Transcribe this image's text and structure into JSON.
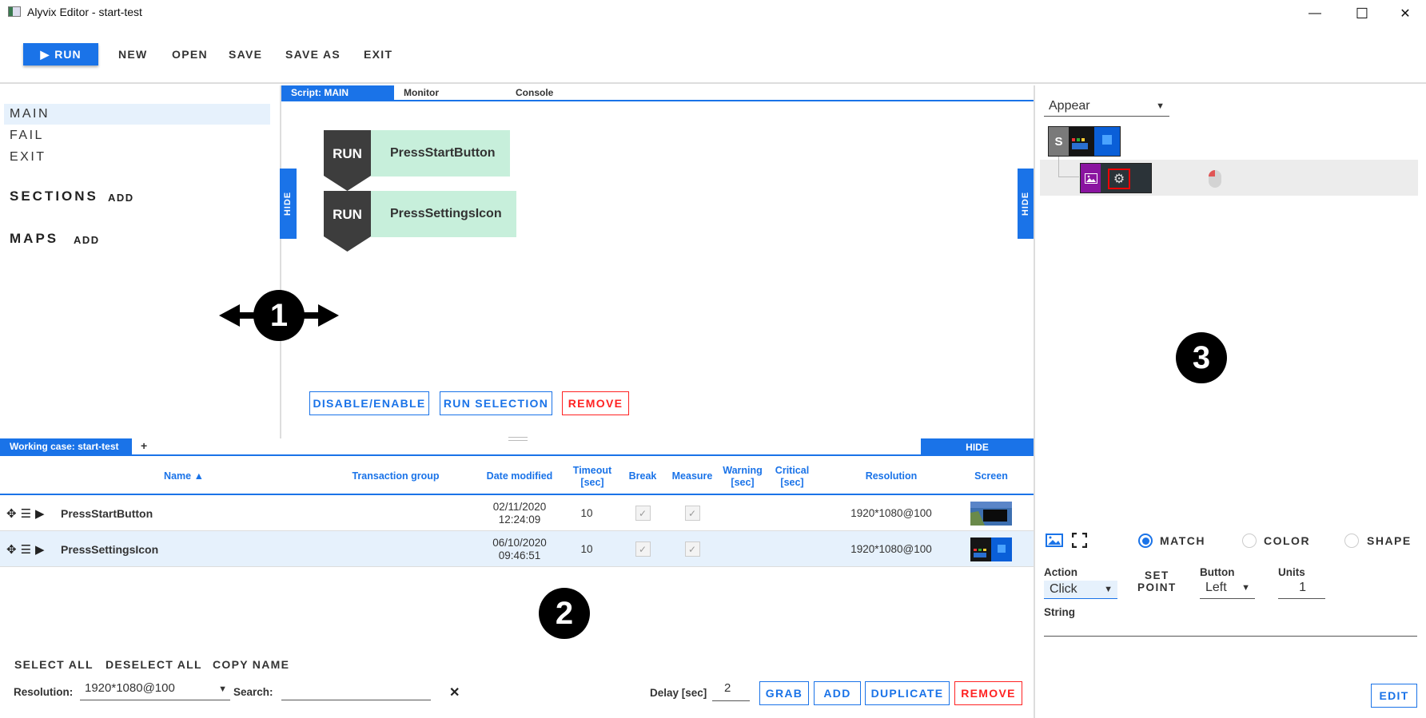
{
  "window": {
    "title": "Alyvix Editor - start-test",
    "controls": {
      "minimize": "—",
      "maximize": "☐",
      "close": "✕"
    }
  },
  "toolbar": {
    "run_label": "RUN",
    "menu": [
      "NEW",
      "OPEN",
      "SAVE",
      "SAVE AS",
      "EXIT"
    ]
  },
  "sidebar": {
    "sections": [
      "MAIN",
      "FAIL",
      "EXIT"
    ],
    "active_section": "MAIN",
    "sections_heading": "SECTIONS",
    "sections_add": "ADD",
    "maps_heading": "MAPS",
    "maps_add": "ADD"
  },
  "center": {
    "tabs": [
      "Script: MAIN",
      "Monitor",
      "Console"
    ],
    "active_tab": "Script: MAIN",
    "hide_label": "HIDE",
    "script_blocks": [
      {
        "keyword": "RUN",
        "name": "PressStartButton"
      },
      {
        "keyword": "RUN",
        "name": "PressSettingsIcon"
      }
    ],
    "buttons": {
      "disable_enable": "DISABLE/ENABLE",
      "run_selection": "RUN SELECTION",
      "remove": "REMOVE"
    }
  },
  "markers": {
    "one": "1",
    "two": "2",
    "three": "3"
  },
  "bottom": {
    "tab_label": "Working case: start-test",
    "add_tab": "+",
    "hide_label": "HIDE",
    "columns": {
      "name": "Name ▲",
      "transaction_group": "Transaction group",
      "date_modified": "Date modified",
      "timeout": "Timeout [sec]",
      "break": "Break",
      "measure": "Measure",
      "warning": "Warning [sec]",
      "critical": "Critical [sec]",
      "resolution": "Resolution",
      "screen": "Screen"
    },
    "rows": [
      {
        "name": "PressStartButton",
        "transaction_group": "",
        "date": "02/11/2020",
        "time": "12:24:09",
        "timeout": "10",
        "break": true,
        "measure": true,
        "warning": "",
        "critical": "",
        "resolution": "1920*1080@100",
        "selected": false
      },
      {
        "name": "PressSettingsIcon",
        "transaction_group": "",
        "date": "06/10/2020",
        "time": "09:46:51",
        "timeout": "10",
        "break": true,
        "measure": true,
        "warning": "",
        "critical": "",
        "resolution": "1920*1080@100",
        "selected": true
      }
    ],
    "actions": {
      "select_all": "SELECT ALL",
      "deselect_all": "DESELECT ALL",
      "copy_name": "COPY NAME"
    },
    "resolution_label": "Resolution:",
    "resolution_value": "1920*1080@100",
    "search_label": "Search:",
    "search_value": "",
    "clear_icon": "✕",
    "delay_label": "Delay [sec]",
    "delay_value": "2",
    "buttons": {
      "grab": "GRAB",
      "add": "ADD",
      "duplicate": "DUPLICATE",
      "remove": "REMOVE"
    }
  },
  "right": {
    "mode_select": "Appear",
    "tree_root_label": "S",
    "methods": [
      "MATCH",
      "COLOR",
      "SHAPE"
    ],
    "selected_method": "MATCH",
    "action_label": "Action",
    "action_value": "Click",
    "set_point_label": [
      "SET",
      "POINT"
    ],
    "button_label": "Button",
    "button_value": "Left",
    "units_label": "Units",
    "units_value": "1",
    "string_label": "String",
    "string_value": "",
    "edit_label": "EDIT"
  },
  "colors": {
    "accent": "#1a73e8",
    "danger": "#ff2222",
    "run_block": "#3d3d3d",
    "block_name_bg": "#c7efdb",
    "selection_bg": "#e6f1fc"
  }
}
